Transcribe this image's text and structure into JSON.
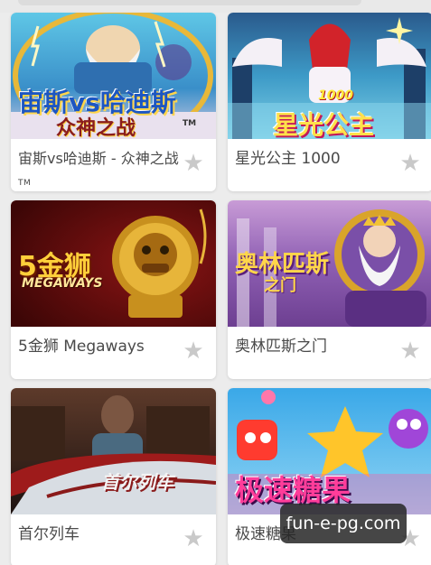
{
  "games": [
    {
      "title": "宙斯vs哈迪斯 - 众神之战",
      "tm": "TM",
      "art_line1": "宙斯vs哈迪斯",
      "art_line2": "众神之战",
      "art_mark": "TM",
      "fav_icon": "star-icon"
    },
    {
      "title": "星光公主 1000",
      "art_badge": "1000",
      "art_title": "星光公主",
      "fav_icon": "star-icon"
    },
    {
      "title": "5金狮 Megaways",
      "art_title": "5金狮",
      "art_sub": "MEGAWAYS",
      "fav_icon": "star-icon"
    },
    {
      "title": "奥林匹斯之门",
      "art_title": "奥林匹斯",
      "art_sub": "之门",
      "fav_icon": "star-icon"
    },
    {
      "title": "首尔列车",
      "art_title": "首尔列车",
      "fav_icon": "star-icon"
    },
    {
      "title": "极速糖果",
      "art_title": "极速糖果",
      "fav_icon": "star-icon"
    }
  ],
  "watermark": "fun-e-pg.com",
  "colors": {
    "card_bg": "#ffffff",
    "page_bg": "#ececec",
    "star": "#c9c9c9",
    "title_text": "#4a4a4a"
  }
}
